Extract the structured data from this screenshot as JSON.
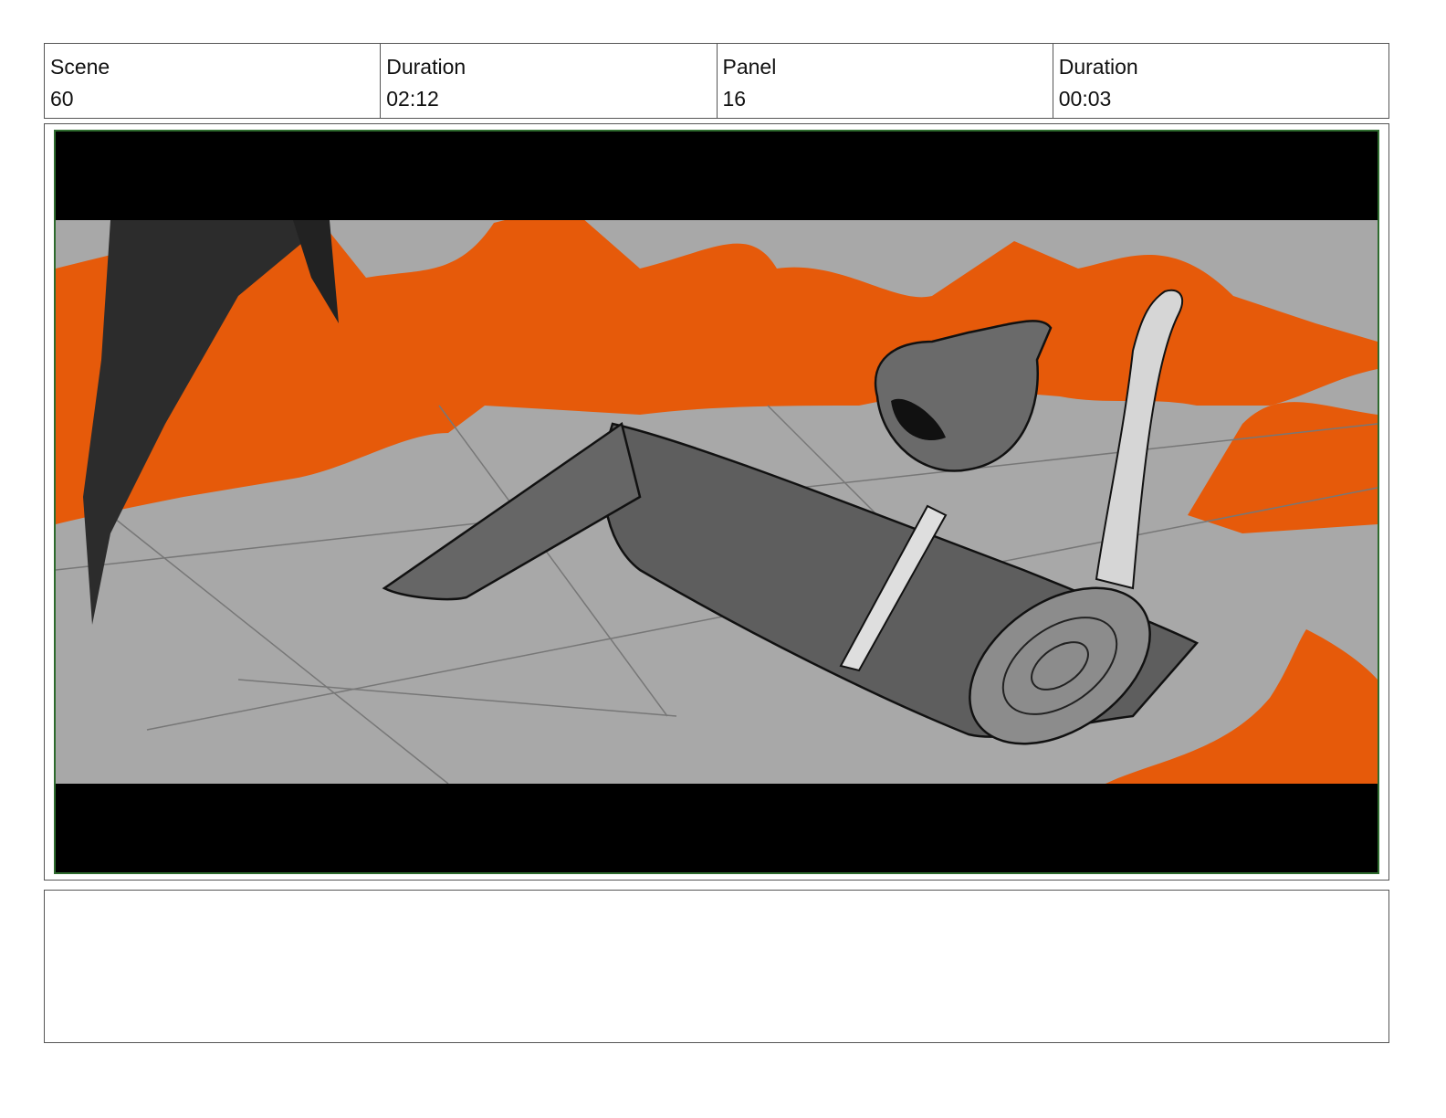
{
  "header": {
    "scene_label": "Scene",
    "scene_value": "60",
    "scene_duration_label": "Duration",
    "scene_duration_value": "02:12",
    "panel_label": "Panel",
    "panel_value": "16",
    "panel_duration_label": "Duration",
    "panel_duration_value": "00:03"
  },
  "colors": {
    "frame_border": "#2e6b2e",
    "lava": "#e65a0a",
    "floor": "#a8a8a8",
    "letterbox": "#000000"
  },
  "notes": {
    "text": ""
  }
}
